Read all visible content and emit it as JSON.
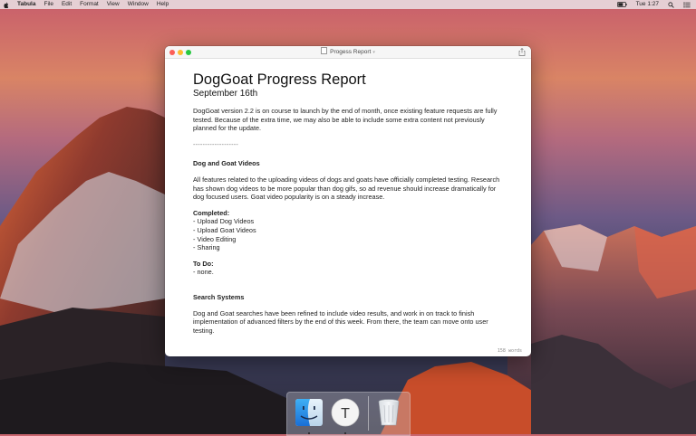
{
  "menubar": {
    "app_name": "Tabula",
    "menus": [
      "File",
      "Edit",
      "Format",
      "View",
      "Window",
      "Help"
    ],
    "clock": "Tue 1:27"
  },
  "window": {
    "title": "Progess Report",
    "word_count": "158 words"
  },
  "document": {
    "title": "DogGoat Progress Report",
    "date": "September 16th",
    "intro": "DogGoat version 2.2 is on course to launch by the end of month, once existing feature requests are fully tested. Because of the extra time, we may also be able to include some extra content not previously planned for the update.",
    "divider": "-------------------",
    "sections": [
      {
        "heading": "Dog and Goat Videos",
        "body": "All features related to the uploading videos of dogs and goats have officially completed testing. Research has shown dog videos to be more popular than dog gifs, so ad revenue should increase dramatically for dog focused users. Goat video popularity is on a steady increase.",
        "completed_label": "Completed:",
        "completed": [
          "- Upload Dog Videos",
          "- Upload Goat Videos",
          "- Video Editing",
          "- Sharing"
        ],
        "todo_label": "To Do:",
        "todo": [
          "- none."
        ]
      },
      {
        "heading": "Search Systems",
        "body": "Dog and Goat searches have been refined to include video results, and work in on track to finish implementation of advanced filters by the end of this week. From there, the team can move onto user testing."
      }
    ]
  },
  "dock": {
    "items": [
      {
        "name": "finder-icon"
      },
      {
        "name": "tabula-icon",
        "letter": "T"
      },
      {
        "name": "trash-icon"
      }
    ]
  },
  "colors": {
    "close": "#fc5f57",
    "minimize": "#fdbc2e",
    "maximize": "#28c840"
  }
}
